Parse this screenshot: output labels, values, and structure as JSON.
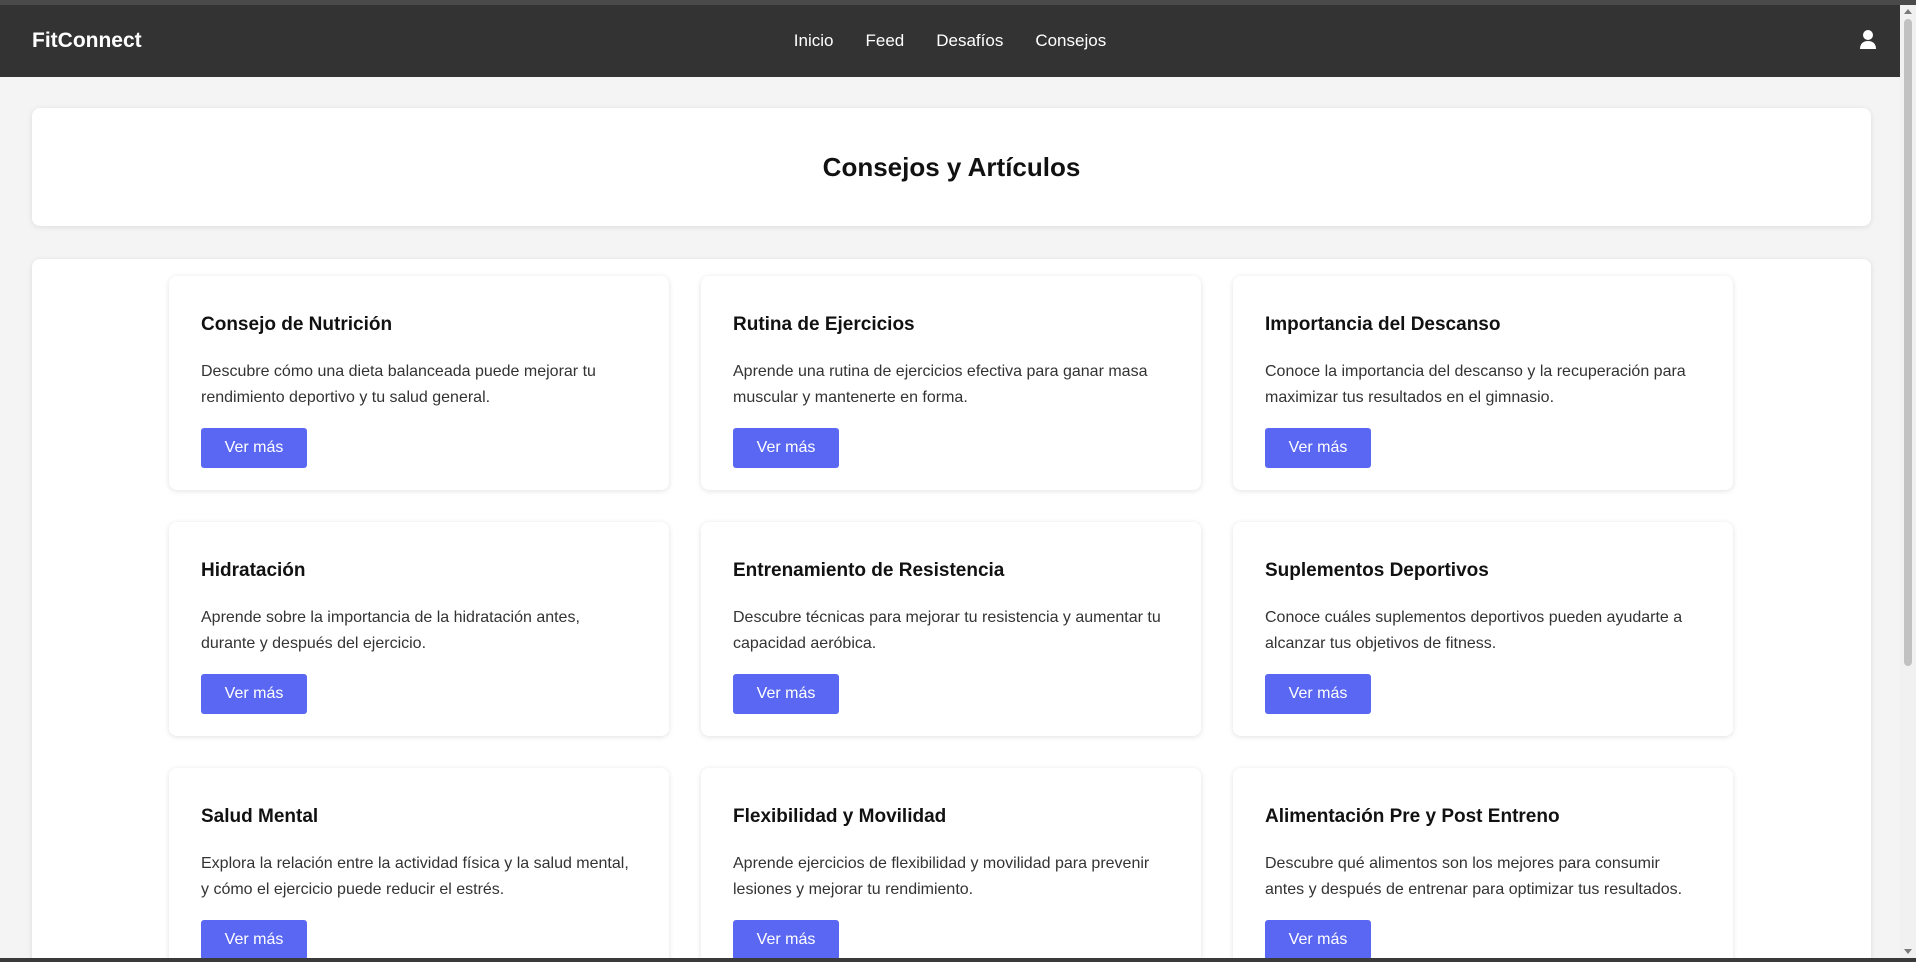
{
  "navbar": {
    "brand": "FitConnect",
    "links": [
      "Inicio",
      "Feed",
      "Desafíos",
      "Consejos"
    ]
  },
  "header": {
    "title": "Consejos y Artículos"
  },
  "cards": [
    {
      "title": "Consejo de Nutrición",
      "text": "Descubre cómo una dieta balanceada puede mejorar tu rendimiento deportivo y tu salud general.",
      "button": "Ver más"
    },
    {
      "title": "Rutina de Ejercicios",
      "text": "Aprende una rutina de ejercicios efectiva para ganar masa muscular y mantenerte en forma.",
      "button": "Ver más"
    },
    {
      "title": "Importancia del Descanso",
      "text": "Conoce la importancia del descanso y la recuperación para maximizar tus resultados en el gimnasio.",
      "button": "Ver más"
    },
    {
      "title": "Hidratación",
      "text": "Aprende sobre la importancia de la hidratación antes, durante y después del ejercicio.",
      "button": "Ver más"
    },
    {
      "title": "Entrenamiento de Resistencia",
      "text": "Descubre técnicas para mejorar tu resistencia y aumentar tu capacidad aeróbica.",
      "button": "Ver más"
    },
    {
      "title": "Suplementos Deportivos",
      "text": "Conoce cuáles suplementos deportivos pueden ayudarte a alcanzar tus objetivos de fitness.",
      "button": "Ver más"
    },
    {
      "title": "Salud Mental",
      "text": "Explora la relación entre la actividad física y la salud mental, y cómo el ejercicio puede reducir el estrés.",
      "button": "Ver más"
    },
    {
      "title": "Flexibilidad y Movilidad",
      "text": "Aprende ejercicios de flexibilidad y movilidad para prevenir lesiones y mejorar tu rendimiento.",
      "button": "Ver más"
    },
    {
      "title": "Alimentación Pre y Post Entreno",
      "text": "Descubre qué alimentos son los mejores para consumir antes y después de entrenar para optimizar tus resultados.",
      "button": "Ver más"
    }
  ],
  "icons": {
    "user": "user-icon"
  },
  "colors": {
    "navbar": "#333333",
    "accent_button": "#5a67f2",
    "background": "#f4f4f4"
  }
}
